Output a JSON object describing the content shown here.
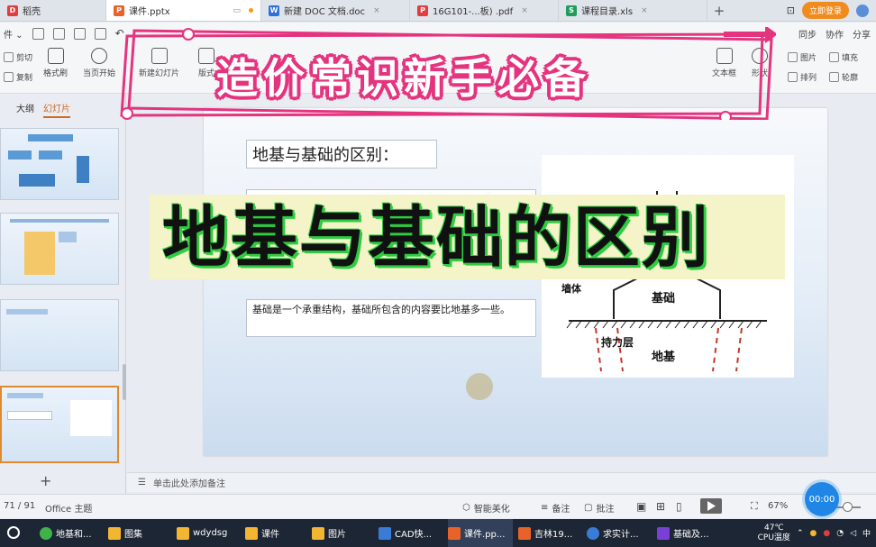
{
  "tabs": [
    {
      "label": "稻壳",
      "icon": "daoke-icon",
      "color": "#e23d3d"
    },
    {
      "label": "课件.pptx",
      "icon": "ppt-icon",
      "color": "#e8632a"
    },
    {
      "label": "新建 DOC 文档.doc",
      "icon": "doc-icon",
      "color": "#2f6fdc"
    },
    {
      "label": "16G101-...板) .pdf",
      "icon": "pdf-icon",
      "color": "#e23d3d"
    },
    {
      "label": "课程目录.xls",
      "icon": "xls-icon",
      "color": "#1f9e5a"
    }
  ],
  "header": {
    "login_label": "立即登录"
  },
  "quickbar": {
    "file_label": "件",
    "right_items": [
      "同步",
      "协作",
      "分享"
    ]
  },
  "ribbon": {
    "cut": "剪切",
    "copy": "复制",
    "format_painter": "格式刷",
    "from_current": "当页开始",
    "new_slide": "新建幻灯片",
    "layout": "版式",
    "textbox": "文本框",
    "shape": "形状",
    "picture": "图片",
    "fill": "填充",
    "arrange": "排列",
    "outline": "轮廓"
  },
  "leftpanel": {
    "tab_outline": "大纲",
    "tab_slides": "幻灯片",
    "add_label": "+"
  },
  "slide": {
    "title": "地基与基础的区别：",
    "body_text": "基础是一个承重结构，基础所包含的内容要比地基多一些。",
    "figure_labels": {
      "wall": "墙体",
      "foundation": "基础",
      "bearing_layer": "持力层",
      "subgrade": "地基"
    }
  },
  "notes": {
    "placeholder": "单击此处添加备注"
  },
  "status": {
    "page": "71 / 91",
    "theme": "Office 主题",
    "smart_beautify": "智能美化",
    "notes_label": "备注",
    "comment_label": "批注",
    "zoom": "67%",
    "timer": "00:00"
  },
  "taskbar": {
    "items": [
      {
        "label": "地基和...",
        "color": "#3fb24a"
      },
      {
        "label": "图集",
        "color": "#f2b632"
      },
      {
        "label": "wdydsg",
        "color": "#f2b632"
      },
      {
        "label": "课件",
        "color": "#f2b632"
      },
      {
        "label": "图片",
        "color": "#f2b632"
      },
      {
        "label": "CAD快...",
        "color": "#3a7bd5"
      },
      {
        "label": "课件.pp...",
        "color": "#e8632a"
      },
      {
        "label": "吉林19...",
        "color": "#e8632a"
      },
      {
        "label": "求实计...",
        "color": "#3a7bd5"
      },
      {
        "label": "基础及...",
        "color": "#7a3fd5"
      }
    ],
    "temp": "47℃",
    "cpu_label": "CPU温度",
    "ime": "中"
  },
  "overlay": {
    "top_banner": "造价常识新手必备",
    "main_banner": "地基与基础的区别"
  }
}
